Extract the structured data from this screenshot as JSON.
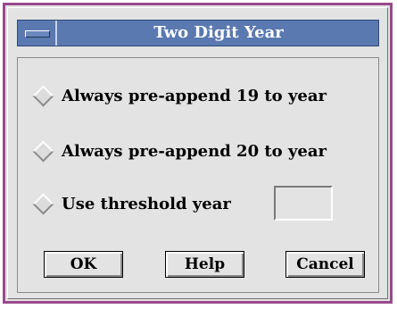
{
  "window": {
    "title": "Two Digit Year",
    "border_color": "#9a4a8c",
    "titlebar_color": "#5a79b0",
    "menu_icon": "window-menu-icon"
  },
  "options": [
    {
      "label": "Always pre-append 19 to year",
      "selected": false
    },
    {
      "label": "Always pre-append 20 to year",
      "selected": false
    },
    {
      "label": "Use threshold year",
      "selected": false
    }
  ],
  "threshold_year": {
    "value": "",
    "placeholder": ""
  },
  "buttons": {
    "ok": "OK",
    "help": "Help",
    "cancel": "Cancel"
  }
}
